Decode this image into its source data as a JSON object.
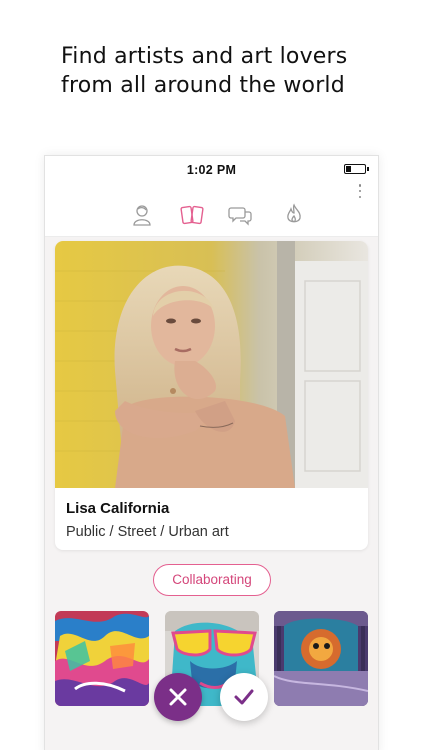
{
  "promo": {
    "line1": "Find artists and art lovers",
    "line2": "from all around the world"
  },
  "status_bar": {
    "time": "1:02 PM",
    "battery_level": 0.3
  },
  "nav": {
    "items": [
      {
        "name": "profile",
        "icon": "user-icon",
        "active": false
      },
      {
        "name": "cards",
        "icon": "cards-icon",
        "active": true
      },
      {
        "name": "chat",
        "icon": "chat-icon",
        "active": false
      },
      {
        "name": "hot",
        "icon": "flame-icon",
        "active": false
      }
    ],
    "menu_icon": "more-vertical-icon"
  },
  "card": {
    "name": "Lisa California",
    "category": "Public / Street / Urban art",
    "photo": "profile-photo"
  },
  "status_pill": "Collaborating",
  "gallery": [
    {
      "name": "graffiti-wall-image"
    },
    {
      "name": "graffiti-face-sunglasses-image"
    },
    {
      "name": "graffiti-room-image"
    }
  ],
  "actions": {
    "reject": "close-icon",
    "accept": "check-icon"
  },
  "colors": {
    "accent_pink": "#e46090",
    "reject_purple": "#7b2f88",
    "accept_check": "#7b2f88"
  }
}
